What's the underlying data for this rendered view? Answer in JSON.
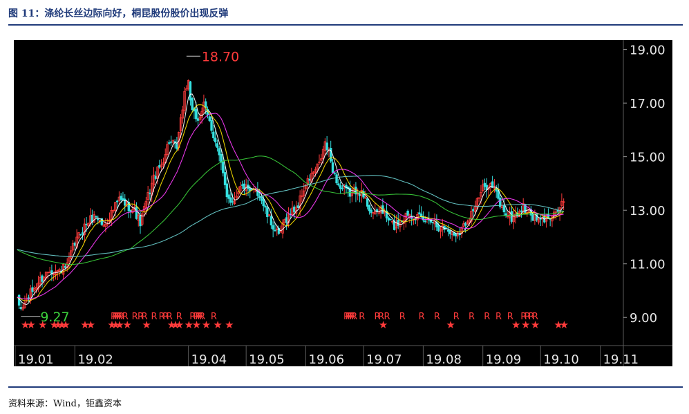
{
  "header": {
    "title": "图 11：涤纶长丝边际向好，桐昆股份股价出现反弹"
  },
  "footer": {
    "source": "资料来源：Wind，钜鑫资本"
  },
  "chart_data": {
    "type": "candlestick",
    "title": "",
    "ylim": [
      8.0,
      19.3
    ],
    "y_ticks": [
      "19.00",
      "17.00",
      "15.00",
      "13.00",
      "11.00",
      "9.00"
    ],
    "y_tick_values": [
      19,
      17,
      15,
      13,
      11,
      9
    ],
    "x_ticks": [
      "19.01",
      "19.02",
      "19.04",
      "19.05",
      "19.06",
      "19.07",
      "19.08",
      "19.09",
      "19.10",
      "19.11"
    ],
    "x_tick_days": [
      0,
      31,
      90,
      120,
      151,
      181,
      212,
      243,
      273,
      304
    ],
    "x_range_days": [
      0,
      316
    ],
    "annotations": {
      "high": {
        "label": "18.70",
        "value": 18.7,
        "day": 89
      },
      "low": {
        "label": "9.27",
        "value": 9.27,
        "day": 3
      }
    },
    "close_anchors": [
      [
        1,
        9.6
      ],
      [
        3,
        9.3
      ],
      [
        8,
        9.9
      ],
      [
        12,
        10.3
      ],
      [
        18,
        10.8
      ],
      [
        22,
        10.7
      ],
      [
        27,
        10.9
      ],
      [
        30,
        11.6
      ],
      [
        34,
        12.2
      ],
      [
        38,
        12.6
      ],
      [
        42,
        12.8
      ],
      [
        46,
        12.4
      ],
      [
        50,
        12.9
      ],
      [
        54,
        13.4
      ],
      [
        58,
        13.2
      ],
      [
        62,
        13.0
      ],
      [
        65,
        12.5
      ],
      [
        68,
        13.3
      ],
      [
        72,
        14.2
      ],
      [
        76,
        14.7
      ],
      [
        80,
        15.6
      ],
      [
        84,
        15.3
      ],
      [
        86,
        16.3
      ],
      [
        88,
        17.4
      ],
      [
        90,
        17.8
      ],
      [
        92,
        16.6
      ],
      [
        95,
        16.4
      ],
      [
        98,
        16.9
      ],
      [
        101,
        16.3
      ],
      [
        104,
        15.6
      ],
      [
        106,
        15.0
      ],
      [
        108,
        14.3
      ],
      [
        110,
        13.6
      ],
      [
        113,
        13.3
      ],
      [
        116,
        13.8
      ],
      [
        119,
        13.9
      ],
      [
        122,
        13.6
      ],
      [
        125,
        13.8
      ],
      [
        128,
        13.4
      ],
      [
        131,
        12.8
      ],
      [
        134,
        12.4
      ],
      [
        137,
        12.0
      ],
      [
        140,
        12.6
      ],
      [
        143,
        12.9
      ],
      [
        147,
        13.2
      ],
      [
        150,
        13.8
      ],
      [
        154,
        14.3
      ],
      [
        158,
        14.7
      ],
      [
        161,
        15.5
      ],
      [
        163,
        15.1
      ],
      [
        166,
        14.3
      ],
      [
        169,
        13.8
      ],
      [
        172,
        13.7
      ],
      [
        175,
        13.6
      ],
      [
        178,
        13.8
      ],
      [
        181,
        13.5
      ],
      [
        184,
        13.1
      ],
      [
        187,
        12.8
      ],
      [
        190,
        13.1
      ],
      [
        193,
        12.7
      ],
      [
        197,
        12.4
      ],
      [
        200,
        12.6
      ],
      [
        204,
        12.9
      ],
      [
        208,
        12.8
      ],
      [
        212,
        12.6
      ],
      [
        216,
        12.7
      ],
      [
        220,
        12.4
      ],
      [
        224,
        12.3
      ],
      [
        228,
        12.1
      ],
      [
        232,
        12.3
      ],
      [
        236,
        12.8
      ],
      [
        240,
        13.3
      ],
      [
        243,
        13.8
      ],
      [
        246,
        14.0
      ],
      [
        249,
        13.8
      ],
      [
        252,
        13.2
      ],
      [
        255,
        12.9
      ],
      [
        258,
        12.7
      ],
      [
        261,
        12.9
      ],
      [
        264,
        13.1
      ],
      [
        267,
        12.9
      ],
      [
        270,
        12.7
      ],
      [
        273,
        12.6
      ],
      [
        276,
        12.7
      ],
      [
        279,
        12.9
      ],
      [
        282,
        13.0
      ],
      [
        285,
        13.3
      ]
    ],
    "moving_averages": [
      {
        "period": 5,
        "color": "#ffffff"
      },
      {
        "period": 10,
        "color": "#ffe400"
      },
      {
        "period": 20,
        "color": "#ff3cff"
      },
      {
        "period": 60,
        "color": "#3cd13c"
      },
      {
        "period": 120,
        "color": "#6ad0d0"
      }
    ],
    "signal_markers": {
      "star_days": [
        5,
        8,
        14,
        20,
        22,
        24,
        26,
        36,
        39,
        50,
        52,
        54,
        58,
        68,
        81,
        83,
        85,
        90,
        94,
        99,
        105,
        111,
        191,
        226,
        260,
        265,
        270,
        282,
        285
      ],
      "r_days": [
        51,
        52,
        53,
        54,
        55,
        57,
        62,
        65,
        67,
        72,
        76,
        78,
        80,
        85,
        92,
        94,
        95,
        96,
        97,
        103,
        172,
        173,
        174,
        175,
        176,
        180,
        188,
        190,
        193,
        201,
        211,
        219,
        229,
        237,
        245,
        251,
        257,
        264,
        266,
        268,
        270
      ]
    }
  }
}
